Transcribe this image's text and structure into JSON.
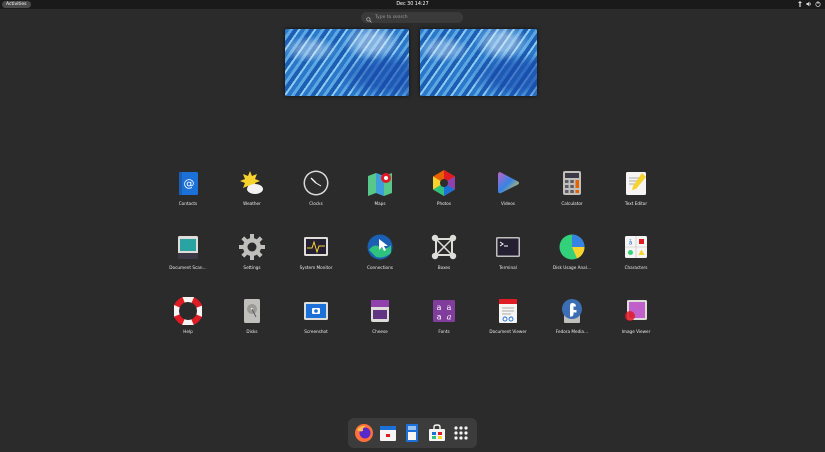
{
  "topbar": {
    "activities_label": "Activities",
    "datetime": "Dec 30  14:27"
  },
  "search": {
    "placeholder": "Type to search"
  },
  "workspaces": [
    "workspace-1",
    "workspace-2"
  ],
  "apps": [
    {
      "label": "Contacts",
      "icon": "contacts-icon"
    },
    {
      "label": "Weather",
      "icon": "weather-icon"
    },
    {
      "label": "Clocks",
      "icon": "clocks-icon"
    },
    {
      "label": "Maps",
      "icon": "maps-icon"
    },
    {
      "label": "Photos",
      "icon": "photos-icon"
    },
    {
      "label": "Videos",
      "icon": "videos-icon"
    },
    {
      "label": "Calculator",
      "icon": "calculator-icon"
    },
    {
      "label": "Text Editor",
      "icon": "text-editor-icon"
    },
    {
      "label": "Document Scan…",
      "icon": "document-scanner-icon"
    },
    {
      "label": "Settings",
      "icon": "settings-icon"
    },
    {
      "label": "System Monitor",
      "icon": "system-monitor-icon"
    },
    {
      "label": "Connections",
      "icon": "connections-icon"
    },
    {
      "label": "Boxes",
      "icon": "boxes-icon"
    },
    {
      "label": "Terminal",
      "icon": "terminal-icon"
    },
    {
      "label": "Disk Usage Anal…",
      "icon": "disk-usage-icon"
    },
    {
      "label": "Characters",
      "icon": "characters-icon"
    },
    {
      "label": "Help",
      "icon": "help-icon"
    },
    {
      "label": "Disks",
      "icon": "disks-icon"
    },
    {
      "label": "Screenshot",
      "icon": "screenshot-icon"
    },
    {
      "label": "Cheese",
      "icon": "cheese-icon"
    },
    {
      "label": "Fonts",
      "icon": "fonts-icon"
    },
    {
      "label": "Document Viewer",
      "icon": "document-viewer-icon"
    },
    {
      "label": "Fedora Media…",
      "icon": "fedora-media-writer-icon"
    },
    {
      "label": "Image Viewer",
      "icon": "image-viewer-icon"
    }
  ],
  "pager": {
    "pages": 2,
    "current": 1
  },
  "dash": [
    "firefox-icon",
    "calendar-icon",
    "files-icon",
    "software-icon",
    "show-apps-icon"
  ],
  "colors": {
    "background": "#2b2b2b",
    "topbar": "#1a1a1a",
    "dash": "#3c3c3c"
  }
}
